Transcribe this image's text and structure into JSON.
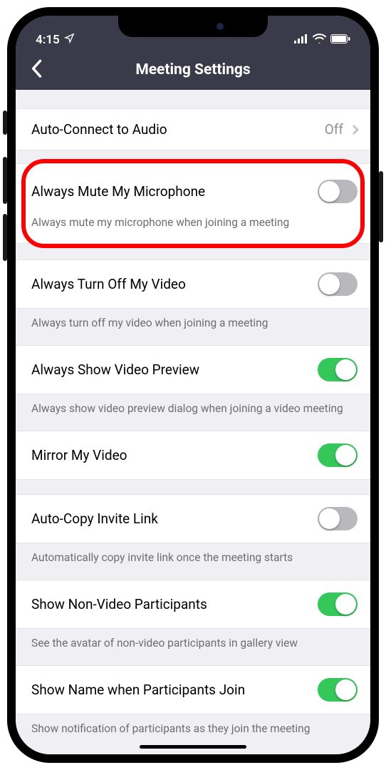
{
  "status": {
    "time": "4:15"
  },
  "header": {
    "title": "Meeting Settings"
  },
  "rows": {
    "audio": {
      "title": "Auto-Connect to Audio",
      "value": "Off"
    },
    "mute": {
      "title": "Always Mute My Microphone",
      "desc": "Always mute my microphone when joining a meeting",
      "on": false
    },
    "video": {
      "title": "Always Turn Off My Video",
      "desc": "Always turn off my video when joining a meeting",
      "on": false
    },
    "preview": {
      "title": "Always Show Video Preview",
      "desc": "Always show video preview dialog when joining a video meeting",
      "on": true
    },
    "mirror": {
      "title": "Mirror My Video",
      "on": true
    },
    "copy": {
      "title": "Auto-Copy Invite Link",
      "desc": "Automatically copy invite link once the meeting starts",
      "on": false
    },
    "nonvideo": {
      "title": "Show Non-Video Participants",
      "desc": "See the avatar of non-video participants in gallery view",
      "on": true
    },
    "showname": {
      "title": "Show Name when Participants Join",
      "desc": "Show notification of participants as they join the meeting",
      "on": true
    }
  }
}
